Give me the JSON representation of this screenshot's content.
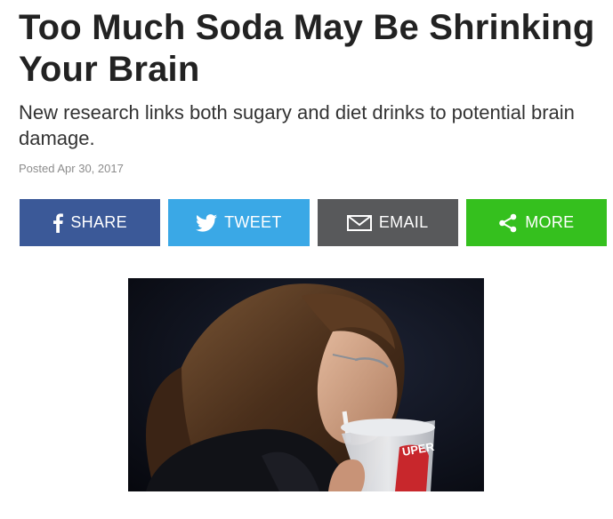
{
  "article": {
    "headline": "Too Much Soda May Be Shrinking Your Brain",
    "subheadline": "New research links both sugary and diet drinks to potential brain damage.",
    "posted": "Posted Apr 30, 2017"
  },
  "share_bar": {
    "buttons": [
      {
        "label": "SHARE",
        "icon": "facebook-icon",
        "color": "#3b5998"
      },
      {
        "label": "TWEET",
        "icon": "twitter-icon",
        "color": "#3aa8e6"
      },
      {
        "label": "EMAIL",
        "icon": "mail-icon",
        "color": "#58595b"
      },
      {
        "label": "MORE",
        "icon": "share-icon",
        "color": "#35c01e"
      }
    ]
  },
  "photo": {
    "cup_text": "UPER"
  }
}
